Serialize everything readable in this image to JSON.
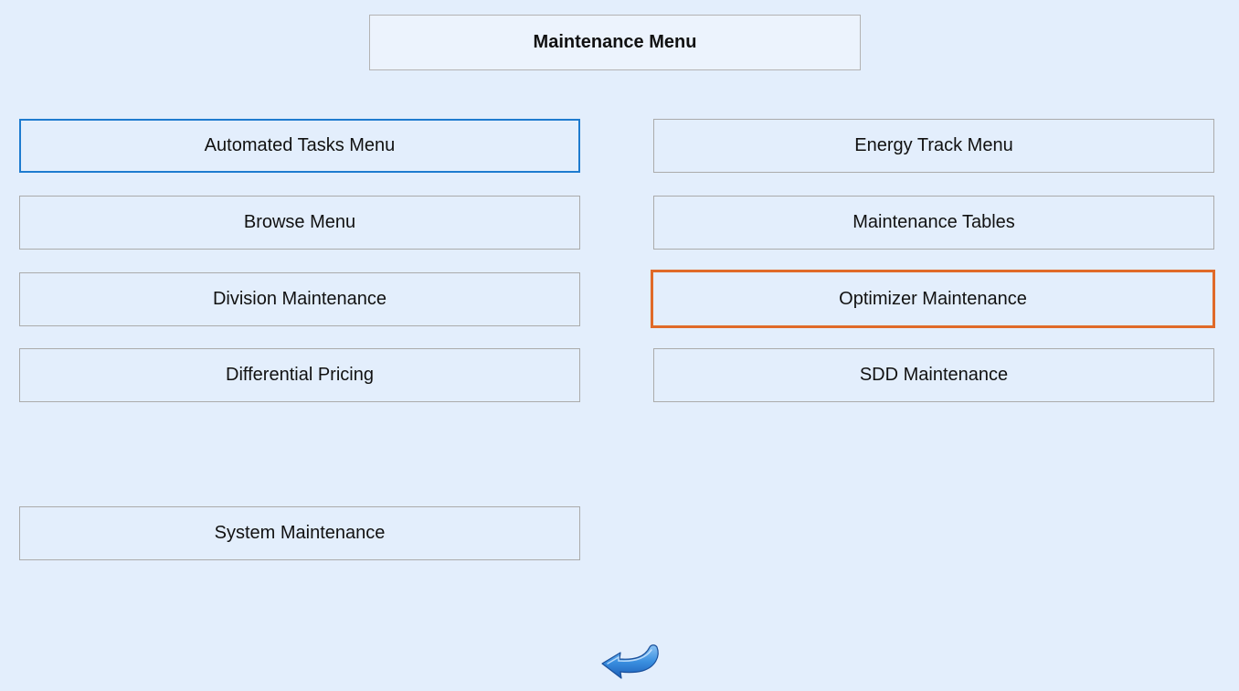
{
  "header": {
    "title": "Maintenance Menu"
  },
  "menu": {
    "automated_tasks": "Automated Tasks Menu",
    "energy_track": "Energy Track Menu",
    "browse": "Browse Menu",
    "maintenance_tables": "Maintenance Tables",
    "division_maintenance": "Division Maintenance",
    "optimizer_maintenance": "Optimizer Maintenance",
    "differential_pricing": "Differential Pricing",
    "sdd_maintenance": "SDD Maintenance",
    "system_maintenance": "System Maintenance"
  },
  "footer": {
    "back_icon": "back-arrow-icon"
  },
  "colors": {
    "background": "#e3eefc",
    "focus_border": "#1e7bcf",
    "selected_border": "#e06a28",
    "arrow": "#2e83d8"
  }
}
